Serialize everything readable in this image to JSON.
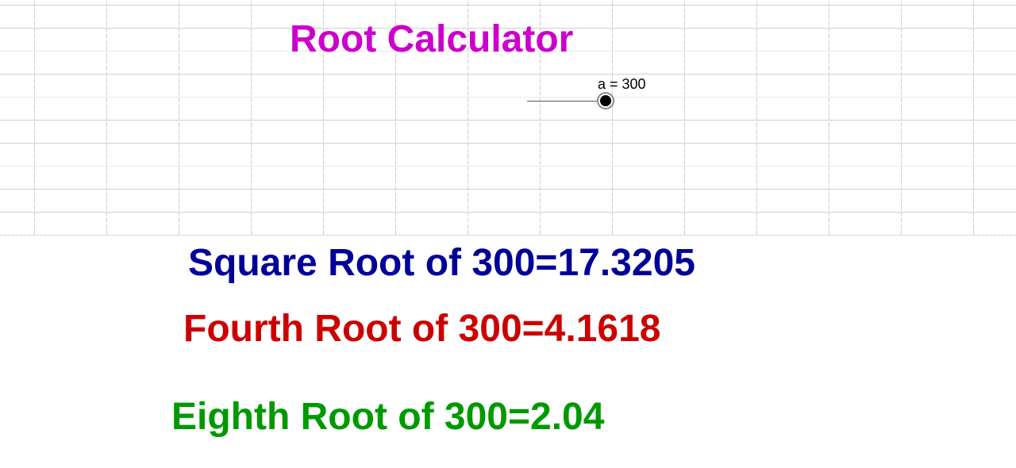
{
  "title": {
    "text": "Root Calculator",
    "color": "#cc00cc"
  },
  "slider": {
    "label": "a = 300",
    "value": 300
  },
  "results": {
    "square": {
      "text": "Square Root of 300=17.3205",
      "color": "#000099"
    },
    "fourth": {
      "text": "Fourth Root of 300=4.1618",
      "color": "#cc0000"
    },
    "eighth": {
      "text": "Eighth Root of 300=2.04",
      "color": "#009900"
    }
  }
}
